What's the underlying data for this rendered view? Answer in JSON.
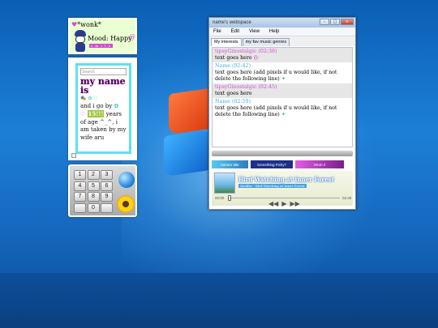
{
  "mood_gadget": {
    "name": "*wonk*",
    "mood": "Mood: Happy",
    "badge": "s m i l e"
  },
  "note_gadget": {
    "search_placeholder": "Search",
    "title": "my name is",
    "line1": "and i go by",
    "number": "15!!!",
    "line2": "years of age ^_^, i am taken by my wife aru"
  },
  "calculator": {
    "keys": [
      "1",
      "2",
      "3",
      "4",
      "5",
      "6",
      "7",
      "8",
      "9",
      "",
      "0",
      ""
    ]
  },
  "window": {
    "title": "name's webspace",
    "menu": [
      "File",
      "Edit",
      "View",
      "Help"
    ],
    "tabs": [
      "My interests",
      "my fav music genres"
    ],
    "entries": [
      {
        "head": "tipsyGinostalgic (02:38)",
        "text": "text goes here",
        "alt": true,
        "blue": false
      },
      {
        "head": "Name (02:42)",
        "text": "text goes here (add pixels if u would like, if not delete the following line)",
        "alt": false,
        "blue": true
      },
      {
        "head": "tipsyGinostalgic (02:45)",
        "text": "text goes here",
        "alt": true,
        "blue": false
      },
      {
        "head": "Name (02:59)",
        "text": "text goes here (add pixels if u would like, if not delete the following line)",
        "alt": false,
        "blue": true
      }
    ],
    "buttons": [
      "banner title",
      "Something Fishy?",
      "Hmm !!"
    ]
  },
  "player": {
    "song": "Bird Watching at Inner Forest",
    "artist": "Snuffer - Bird Watching at Inner Forest",
    "time_current": "00:00",
    "time_total": "02:49",
    "progress": 0.0
  }
}
